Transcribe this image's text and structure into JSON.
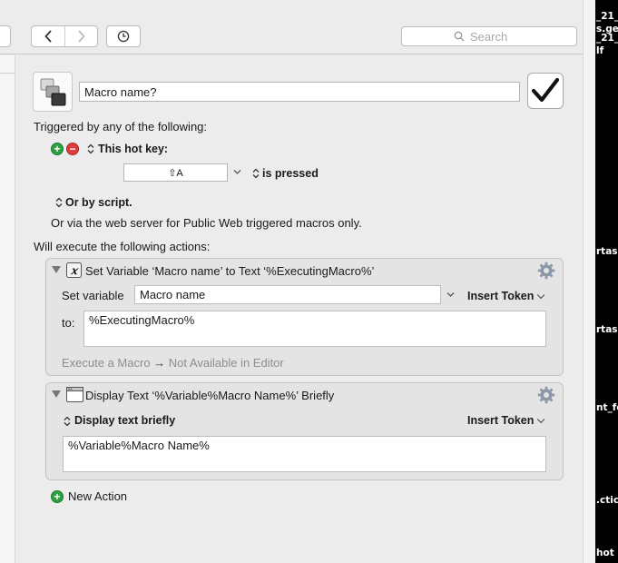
{
  "toolbar": {
    "back_icon": "chevron-left-icon",
    "forward_icon": "chevron-right-icon",
    "history_icon": "clock-icon",
    "search_placeholder": "Search"
  },
  "macro": {
    "name_value": "Macro name?",
    "enabled": true
  },
  "triggers": {
    "heading": "Triggered by any of the following:",
    "hotkey_label": "This hot key:",
    "hotkey_value": "⇧A",
    "pressed_label": "is pressed",
    "script_label": "Or by script.",
    "web_server_text": "Or via the web server for Public Web triggered macros only."
  },
  "actions_heading": "Will execute the following actions:",
  "actions": [
    {
      "title": "Set Variable ‘Macro name’ to Text ‘%ExecutingMacro%’",
      "set_variable_label": "Set variable",
      "variable_value": "Macro name",
      "insert_token_label": "Insert Token",
      "to_label": "to:",
      "to_value": "%ExecutingMacro%",
      "footer_left": "Execute a Macro",
      "footer_arrow": "→",
      "footer_right": "Not Available in Editor"
    },
    {
      "title": "Display Text ‘%Variable%Macro Name%’ Briefly",
      "mode_label": "Display text briefly",
      "insert_token_label": "Insert Token",
      "text_value": "%Variable%Macro Name%"
    }
  ],
  "new_action_label": "New Action",
  "background_window": {
    "fragments": [
      "_21_",
      "s.geo",
      "_21_",
      "lf",
      "rtas",
      "rtas",
      "nt_fo",
      ".ctic",
      "hot"
    ]
  }
}
